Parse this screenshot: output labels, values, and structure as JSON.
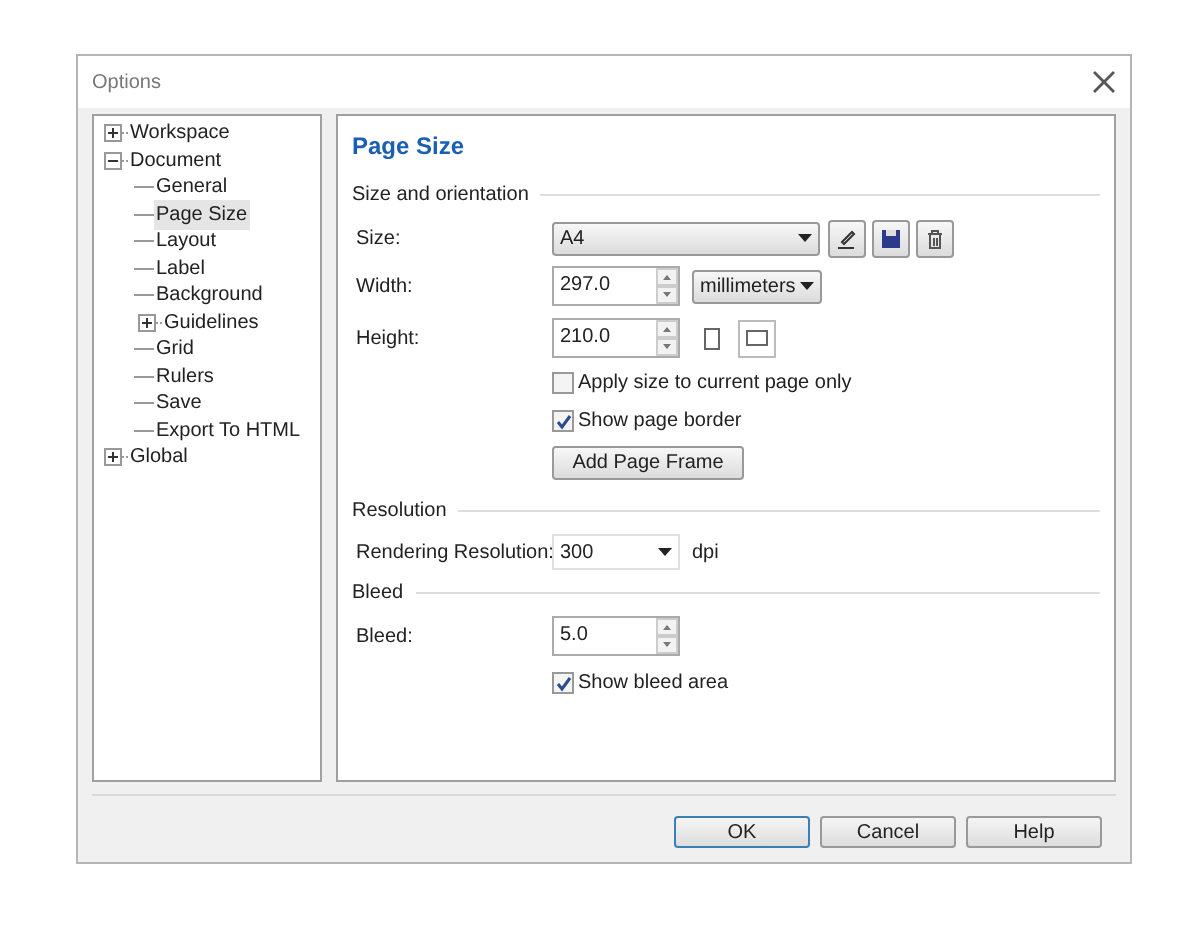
{
  "window": {
    "title": "Options"
  },
  "tree": [
    {
      "label": "Workspace",
      "expanded": false,
      "selected": false
    },
    {
      "label": "Document",
      "expanded": true,
      "selected": false,
      "children": [
        {
          "label": "General",
          "selected": false
        },
        {
          "label": "Page Size",
          "selected": true
        },
        {
          "label": "Layout",
          "selected": false
        },
        {
          "label": "Label",
          "selected": false
        },
        {
          "label": "Background",
          "selected": false
        },
        {
          "label": "Guidelines",
          "expanded": false,
          "selected": false
        },
        {
          "label": "Grid",
          "selected": false
        },
        {
          "label": "Rulers",
          "selected": false
        },
        {
          "label": "Save",
          "selected": false
        },
        {
          "label": "Export To HTML",
          "selected": false
        }
      ]
    },
    {
      "label": "Global",
      "expanded": false,
      "selected": false
    }
  ],
  "page": {
    "title": "Page Size",
    "size_orientation": {
      "heading": "Size and orientation",
      "size": {
        "label": "Size:",
        "value": "A4"
      },
      "width": {
        "label": "Width:",
        "value": "297.0",
        "unit": "millimeters"
      },
      "height": {
        "label": "Height:",
        "value": "210.0",
        "orientations": [
          {
            "kind": "portrait",
            "selected": false
          },
          {
            "kind": "landscape",
            "selected": true
          }
        ]
      },
      "apply_current": {
        "label": "Apply size to current page only",
        "checked": false
      },
      "show_border": {
        "label": "Show page border",
        "checked": true
      },
      "add_frame": "Add Page Frame"
    },
    "resolution": {
      "heading": "Resolution",
      "label": "Rendering Resolution:",
      "value": "300",
      "unit": "dpi"
    },
    "bleed": {
      "heading": "Bleed",
      "label": "Bleed:",
      "value": "5.0",
      "show_area": {
        "label": "Show bleed area",
        "checked": true
      }
    }
  },
  "buttons": [
    {
      "label": "OK",
      "default": true
    },
    {
      "label": "Cancel",
      "default": false
    },
    {
      "label": "Help",
      "default": false
    }
  ]
}
